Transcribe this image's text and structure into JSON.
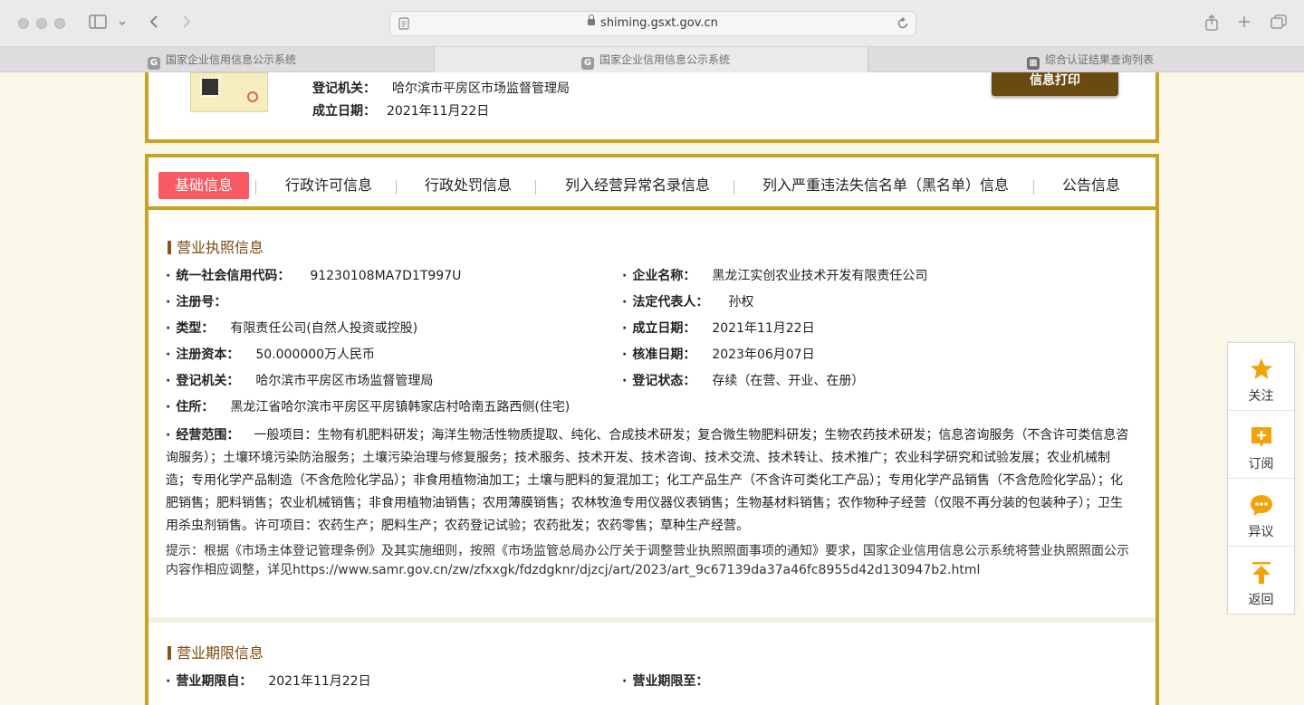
{
  "browser": {
    "url": "shiming.gsxt.gov.cn",
    "tabs": [
      {
        "label": "国家企业信用信息公示系统",
        "favicon": "G"
      },
      {
        "label": "国家企业信用信息公示系统",
        "favicon": "G"
      },
      {
        "label": "综合认证结果查询列表",
        "favicon": "grid"
      }
    ]
  },
  "header": {
    "reg_authority_label": "登记机关：",
    "reg_authority_value": "哈尔滨市平房区市场监督管理局",
    "established_label": "成立日期：",
    "established_value": "2021年11月22日",
    "print_button": "信息打印"
  },
  "nav": {
    "tabs": [
      "基础信息",
      "行政许可信息",
      "行政处罚信息",
      "列入经营异常名录信息",
      "列入严重违法失信名单（黑名单）信息",
      "公告信息"
    ]
  },
  "license": {
    "title": "营业执照信息",
    "credit_code_label": "统一社会信用代码：",
    "credit_code_value": "91230108MA7D1T997U",
    "company_name_label": "企业名称：",
    "company_name_value": "黑龙江实创农业技术开发有限责任公司",
    "reg_no_label": "注册号：",
    "legal_rep_label": "法定代表人：",
    "legal_rep_value": "孙权",
    "type_label": "类型：",
    "type_value": "有限责任公司(自然人投资或控股)",
    "established_label": "成立日期：",
    "established_value": "2021年11月22日",
    "capital_label": "注册资本：",
    "capital_value": "50.000000万人民币",
    "approved_label": "核准日期：",
    "approved_value": "2023年06月07日",
    "authority_label": "登记机关：",
    "authority_value": "哈尔滨市平房区市场监督管理局",
    "status_label": "登记状态：",
    "status_value": "存续（在营、开业、在册）",
    "address_label": "住所：",
    "address_value": "黑龙江省哈尔滨市平房区平房镇韩家店村哈南五路西侧(住宅)",
    "scope_label": "经营范围：",
    "scope_value": "一般项目：生物有机肥料研发；海洋生物活性物质提取、纯化、合成技术研发；复合微生物肥料研发；生物农药技术研发；信息咨询服务（不含许可类信息咨询服务）；土壤环境污染防治服务；土壤污染治理与修复服务；技术服务、技术开发、技术咨询、技术交流、技术转让、技术推广；农业科学研究和试验发展；农业机械制造；专用化学产品制造（不含危险化学品）；非食用植物油加工；土壤与肥料的复混加工；化工产品生产（不含许可类化工产品）；专用化学产品销售（不含危险化学品）；化肥销售；肥料销售；农业机械销售；非食用植物油销售；农用薄膜销售；农林牧渔专用仪器仪表销售；生物基材料销售；农作物种子经营（仅限不再分装的包装种子）；卫生用杀虫剂销售。许可项目：农药生产；肥料生产；农药登记试验；农药批发；农药零售；草种生产经营。",
    "tip": "提示：根据《市场主体登记管理条例》及其实施细则，按照《市场监管总局办公厅关于调整营业执照照面事项的通知》要求，国家企业信用信息公示系统将营业执照照面公示内容作相应调整，详见https://www.samr.gov.cn/zw/zfxxgk/fdzdgknr/djzcj/art/2023/art_9c67139da37a46fc8955d42d130947b2.html"
  },
  "term": {
    "title": "营业期限信息",
    "from_label": "营业期限自：",
    "from_value": "2021年11月22日",
    "to_label": "营业期限至："
  },
  "sidebar": {
    "follow": "关注",
    "subscribe": "订阅",
    "objection": "异议",
    "back": "返回"
  },
  "colors": {
    "frame": "#c9a220",
    "active_tab": "#f85a63",
    "print_button": "#6b4a12",
    "icon": "#f4a20a"
  }
}
